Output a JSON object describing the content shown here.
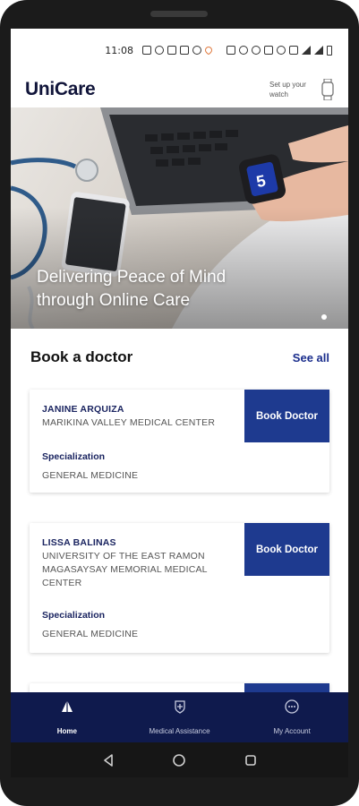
{
  "status_bar": {
    "time": "11:08",
    "icons": [
      "sim-icon",
      "bluetooth-icon",
      "telegram-icon",
      "youtube-icon",
      "chrome-icon",
      "heart-icon",
      "nfc-icon",
      "alarm-icon",
      "bluetooth-icon",
      "mute-icon",
      "wifi-icon",
      "volte-icon",
      "signal-icon",
      "signal-icon",
      "battery-icon"
    ]
  },
  "header": {
    "logo": "UniCare",
    "watch_prompt": "Set up your watch"
  },
  "hero": {
    "caption": "Delivering Peace of Mind through Online Care",
    "slide_index": 1
  },
  "booking": {
    "title": "Book a doctor",
    "see_all": "See all",
    "doctors": [
      {
        "name": "JANINE ARQUIZA",
        "hospital": "MARIKINA VALLEY MEDICAL CENTER",
        "specialization_label": "Specialization",
        "specialization": "GENERAL MEDICINE",
        "button": "Book Doctor"
      },
      {
        "name": "LISSA BALINAS",
        "hospital": "UNIVERSITY OF THE EAST RAMON MAGASAYSAY MEMORIAL MEDICAL CENTER",
        "specialization_label": "Specialization",
        "specialization": "GENERAL MEDICINE",
        "button": "Book Doctor"
      }
    ]
  },
  "bottom_nav": {
    "items": [
      {
        "label": "Home",
        "icon": "home-drop-icon",
        "active": true
      },
      {
        "label": "Medical Assistance",
        "icon": "medical-shield-icon",
        "active": false
      },
      {
        "label": "My Account",
        "icon": "account-dots-icon",
        "active": false
      }
    ]
  },
  "system_nav": {
    "icons": [
      "back-icon",
      "home-icon",
      "recents-icon"
    ]
  },
  "colors": {
    "brand_navy": "#0f1a4d",
    "button_blue": "#1e3a8f",
    "link_blue": "#1a2d8c"
  }
}
